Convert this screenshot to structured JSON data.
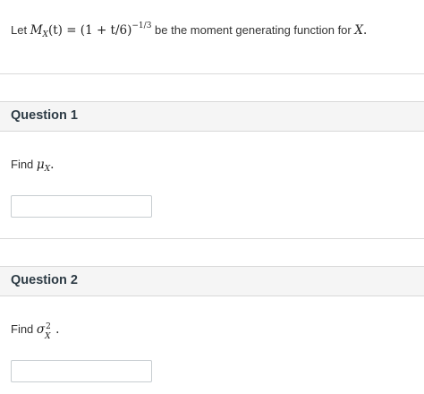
{
  "intro": {
    "prefix": "Let",
    "mgf_M": "M",
    "mgf_sub": "X",
    "mgf_rest": "(t) = (1 + t/6)",
    "mgf_exp": "−1/3",
    "suffix": "be the moment generating function for",
    "var": "X",
    "end": "."
  },
  "questions": [
    {
      "title": "Question 1",
      "prompt_prefix": "Find",
      "symbol": "μ",
      "symbol_sub": "X",
      "end": ".",
      "answer_value": ""
    },
    {
      "title": "Question 2",
      "prompt_prefix": "Find",
      "symbol": "σ",
      "symbol_sup": "2",
      "symbol_sub": "X",
      "end": ".",
      "answer_value": ""
    }
  ]
}
